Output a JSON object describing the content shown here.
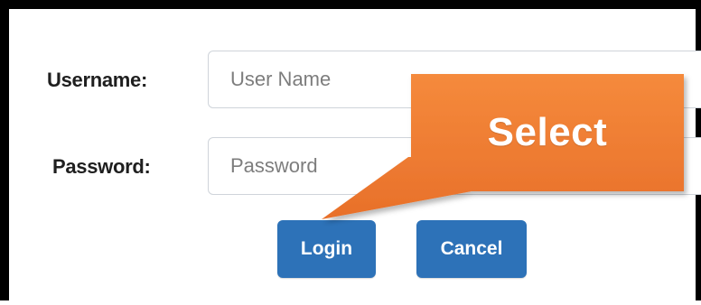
{
  "form": {
    "username_label": "Username:",
    "username_placeholder": "User Name",
    "username_value": "",
    "password_label": "Password:",
    "password_placeholder": "Password",
    "password_value": "",
    "login_label": "Login",
    "cancel_label": "Cancel"
  },
  "callout": {
    "text": "Select",
    "color": "#ee7a2f"
  },
  "colors": {
    "button_primary": "#2d72b8",
    "frame": "#000000"
  }
}
